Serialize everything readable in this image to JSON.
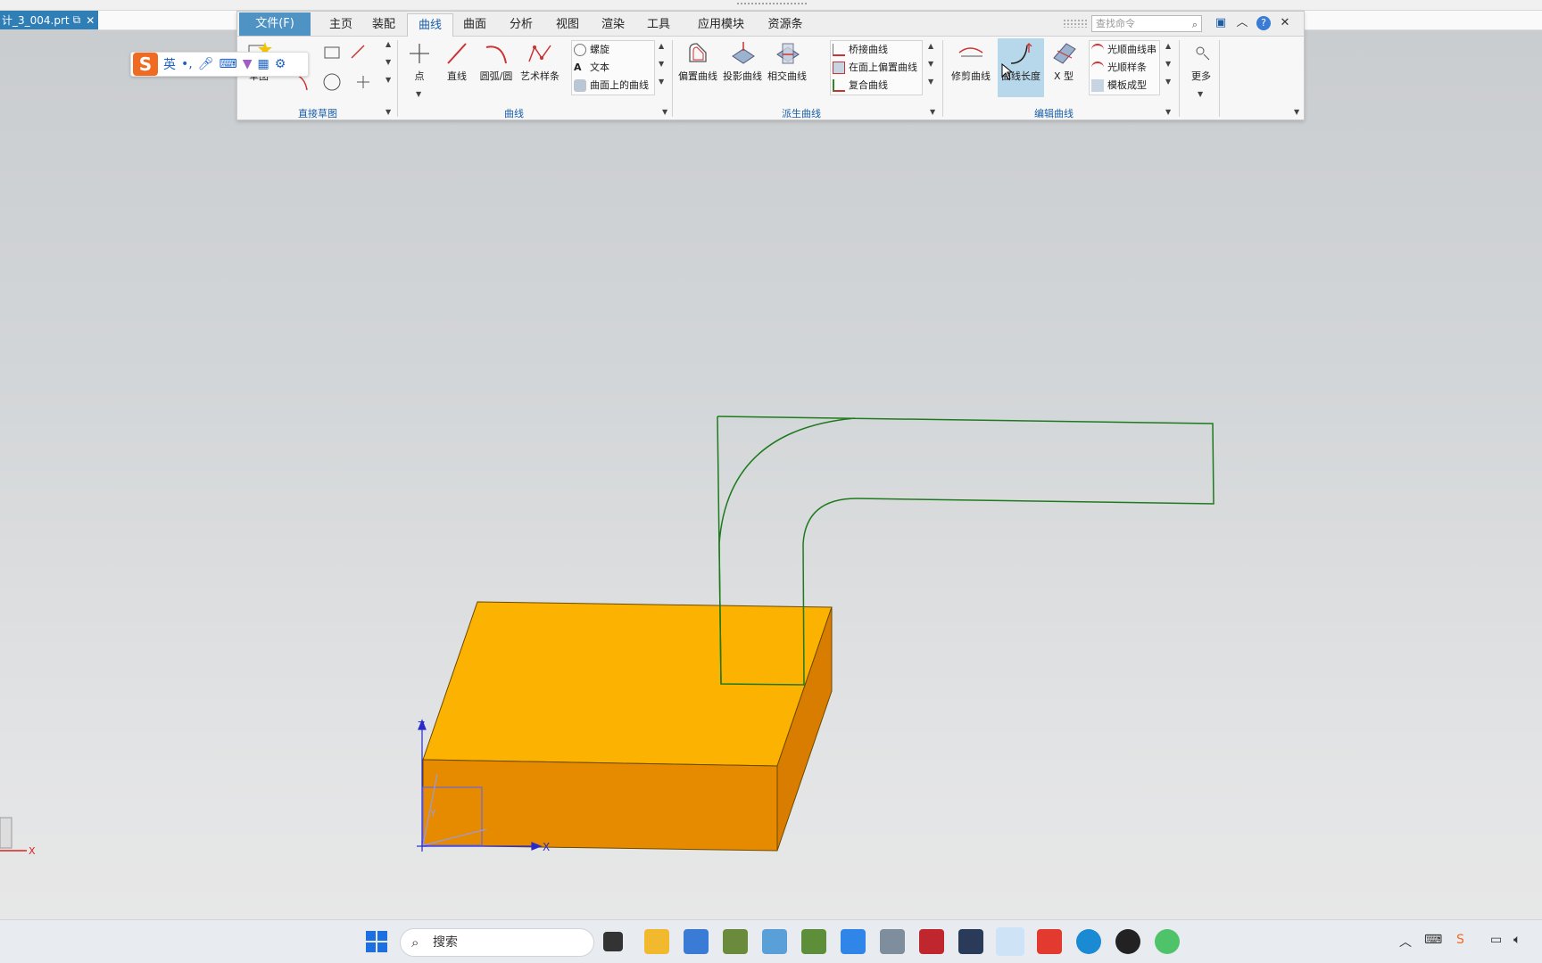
{
  "document": {
    "tab_title": "计_3_004.prt"
  },
  "ribbon": {
    "tabs": [
      {
        "label": "文件(F)"
      },
      {
        "label": "主页"
      },
      {
        "label": "装配"
      },
      {
        "label": "曲线"
      },
      {
        "label": "曲面"
      },
      {
        "label": "分析"
      },
      {
        "label": "视图"
      },
      {
        "label": "渲染"
      },
      {
        "label": "工具"
      },
      {
        "label": "应用模块"
      },
      {
        "label": "资源条"
      }
    ],
    "search_placeholder": "查找命令",
    "groups": {
      "direct_sketch": {
        "label": "直接草图",
        "sketch_label": "草图"
      },
      "curve": {
        "label": "曲线",
        "buttons": [
          "点",
          "直线",
          "圆弧/圆",
          "艺术样条"
        ],
        "list": [
          "螺旋",
          "文本",
          "曲面上的曲线"
        ]
      },
      "derived": {
        "label": "派生曲线",
        "buttons": [
          "偏置曲线",
          "投影曲线",
          "相交曲线"
        ],
        "list": [
          "桥接曲线",
          "在面上偏置曲线",
          "复合曲线"
        ]
      },
      "edit": {
        "label": "编辑曲线",
        "buttons": [
          "修剪曲线",
          "曲线长度",
          "X 型"
        ],
        "list": [
          "光顺曲线串",
          "光顺样条",
          "模板成型"
        ]
      },
      "more": {
        "label": "更多"
      }
    }
  },
  "ime": {
    "mode_label": "英"
  },
  "viewport": {
    "axis_labels": {
      "z": "Z",
      "x": "X",
      "y": "Y",
      "corner_x": "X"
    },
    "colors": {
      "block_top": "#fcb200",
      "block_front": "#e68a00",
      "block_side": "#d97d00",
      "curve": "#1e7a1e"
    }
  },
  "taskbar": {
    "search_label": "搜索"
  }
}
